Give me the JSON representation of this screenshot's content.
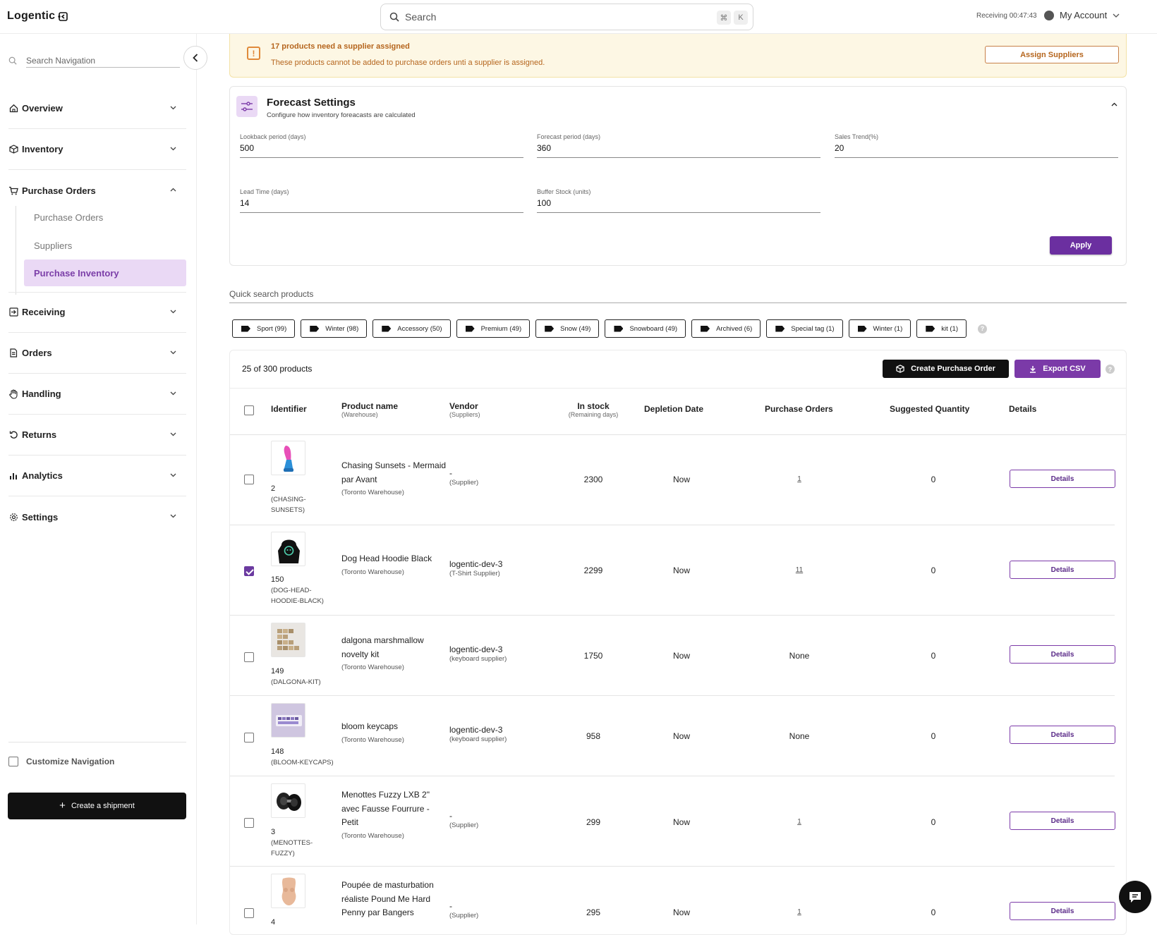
{
  "app": {
    "logo": "Logentic",
    "search_placeholder": "Search",
    "kbd_cmd": "⌘",
    "kbd_k": "K",
    "receiving_timer": "Receiving 00:47:43",
    "account": "My Account"
  },
  "sidebar": {
    "search_placeholder": "Search Navigation",
    "sections": [
      {
        "label": "Overview",
        "icon": "home-icon"
      },
      {
        "label": "Inventory",
        "icon": "box-icon"
      },
      {
        "label": "Purchase Orders",
        "icon": "cart-icon"
      },
      {
        "label": "Receiving",
        "icon": "receiving-icon"
      },
      {
        "label": "Orders",
        "icon": "document-icon"
      },
      {
        "label": "Handling",
        "icon": "hand-icon"
      },
      {
        "label": "Returns",
        "icon": "returns-icon"
      },
      {
        "label": "Analytics",
        "icon": "bar-chart-icon"
      },
      {
        "label": "Settings",
        "icon": "gear-icon"
      }
    ],
    "subitems": [
      "Purchase Orders",
      "Suppliers",
      "Purchase Inventory"
    ],
    "customize": "Customize Navigation",
    "create_shipment": "Create a shipment"
  },
  "alert": {
    "title": "17 products need a supplier assigned",
    "message": "These products cannot be added to purchase orders unti a supplier is assigned.",
    "button": "Assign Suppliers"
  },
  "forecast": {
    "title": "Forecast Settings",
    "subtitle": "Configure how inventory foreacasts are calculated",
    "fields": [
      {
        "label": "Lookback period (days)",
        "value": "500"
      },
      {
        "label": "Forecast period (days)",
        "value": "360"
      },
      {
        "label": "Sales Trend(%)",
        "value": "20"
      },
      {
        "label": "Lead Time (days)",
        "value": "14"
      },
      {
        "label": "Buffer Stock (units)",
        "value": "100"
      }
    ],
    "apply": "Apply"
  },
  "quick_search": {
    "placeholder": "Quick search products",
    "tags": [
      "Sport (99)",
      "Winter (98)",
      "Accessory (50)",
      "Premium (49)",
      "Snow (49)",
      "Snowboard (49)",
      "Archived (6)",
      "Special tag (1)",
      "Winter (1)",
      "kit (1)"
    ],
    "help": "?"
  },
  "table": {
    "count": "25 of 300 products",
    "create_po": "Create Purchase Order",
    "export": "Export CSV",
    "help": "?",
    "headers": {
      "identifier": "Identifier",
      "product_name": "Product name",
      "product_name_sub": "(Warehouse)",
      "vendor": "Vendor",
      "vendor_sub": "(Suppliers)",
      "in_stock": "In stock",
      "in_stock_sub": "(Remaining days)",
      "depletion": "Depletion Date",
      "purchase_orders": "Purchase Orders",
      "suggested": "Suggested Quantity",
      "details": "Details"
    },
    "rows": [
      {
        "id": "2",
        "sku": "(CHASING-\nSUNSETS)",
        "name": "Chasing Sunsets - Mermaid par Avant",
        "warehouse": "(Toronto Warehouse)",
        "vendor": "-",
        "supplier": "(Supplier)",
        "stock": "2300",
        "depletion": "Now",
        "po": "1",
        "po_link": true,
        "suggested": "0",
        "details": "Details",
        "checked": false
      },
      {
        "id": "150",
        "sku": "(DOG-HEAD-\nHOODIE-BLACK)",
        "name": "Dog Head Hoodie Black",
        "warehouse": "(Toronto Warehouse)",
        "vendor": "logentic-dev-3",
        "supplier": "(T-Shirt Supplier)",
        "stock": "2299",
        "depletion": "Now",
        "po": "11",
        "po_link": true,
        "suggested": "0",
        "details": "Details",
        "checked": true
      },
      {
        "id": "149",
        "sku": "(DALGONA-KIT)",
        "name": "dalgona marshmallow novelty kit",
        "warehouse": "(Toronto Warehouse)",
        "vendor": "logentic-dev-3",
        "supplier": "(keyboard supplier)",
        "stock": "1750",
        "depletion": "Now",
        "po": "None",
        "po_link": false,
        "suggested": "0",
        "details": "Details",
        "checked": false
      },
      {
        "id": "148",
        "sku": "(BLOOM-KEYCAPS)",
        "name": "bloom keycaps",
        "warehouse": "(Toronto Warehouse)",
        "vendor": "logentic-dev-3",
        "supplier": "(keyboard supplier)",
        "stock": "958",
        "depletion": "Now",
        "po": "None",
        "po_link": false,
        "suggested": "0",
        "details": "Details",
        "checked": false
      },
      {
        "id": "3",
        "sku": "(MENOTTES-\nFUZZY)",
        "name": "Menottes Fuzzy LXB 2\" avec Fausse Fourrure - Petit",
        "warehouse": "(Toronto Warehouse)",
        "vendor": "-",
        "supplier": "(Supplier)",
        "stock": "299",
        "depletion": "Now",
        "po": "1",
        "po_link": true,
        "suggested": "0",
        "details": "Details",
        "checked": false
      },
      {
        "id": "4",
        "sku": "",
        "name": "Poupée de masturbation réaliste Pound Me Hard Penny par Bangers",
        "warehouse": "",
        "vendor": "-",
        "supplier": "(Supplier)",
        "stock": "295",
        "depletion": "Now",
        "po": "1",
        "po_link": true,
        "suggested": "0",
        "details": "Details",
        "checked": false
      }
    ]
  },
  "colors": {
    "accent": "#6b2fa0",
    "accent_light": "#ead9f5",
    "warning_bg": "#fdf7e4",
    "warning_text": "#b5651d"
  }
}
